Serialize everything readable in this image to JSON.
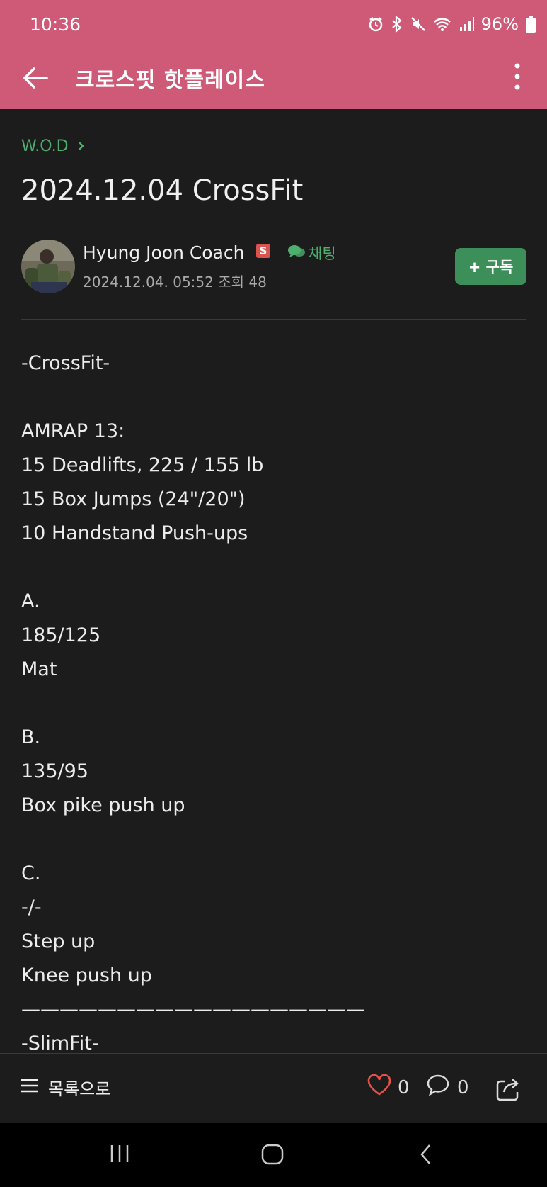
{
  "status": {
    "time": "10:36",
    "battery": "96%"
  },
  "appbar": {
    "title": "크로스핏 핫플레이스"
  },
  "post": {
    "breadcrumb": "W.O.D",
    "title": "2024.12.04 CrossFit",
    "author": "Hyung Joon Coach",
    "author_badge": "S",
    "chat_label": "채팅",
    "meta": "2024.12.04. 05:52 조회 48",
    "subscribe_label": "+ 구독",
    "body": [
      "-CrossFit-",
      "",
      "AMRAP 13:",
      "15 Deadlifts, 225 / 155 lb",
      "15 Box Jumps (24\"/20\")",
      "10 Handstand Push-ups",
      "",
      "A.",
      "185/125",
      "Mat",
      "",
      "B.",
      "135/95",
      "Box pike push up",
      "",
      "C.",
      "-/-",
      "Step up",
      "Knee push up",
      "——————————————————",
      "-SlimFit-"
    ]
  },
  "bottombar": {
    "list_label": "목록으로",
    "like_count": "0",
    "comment_count": "0"
  },
  "colors": {
    "header": "#cf5a77",
    "accent_green": "#4caf6d",
    "background": "#1c1c1c"
  }
}
